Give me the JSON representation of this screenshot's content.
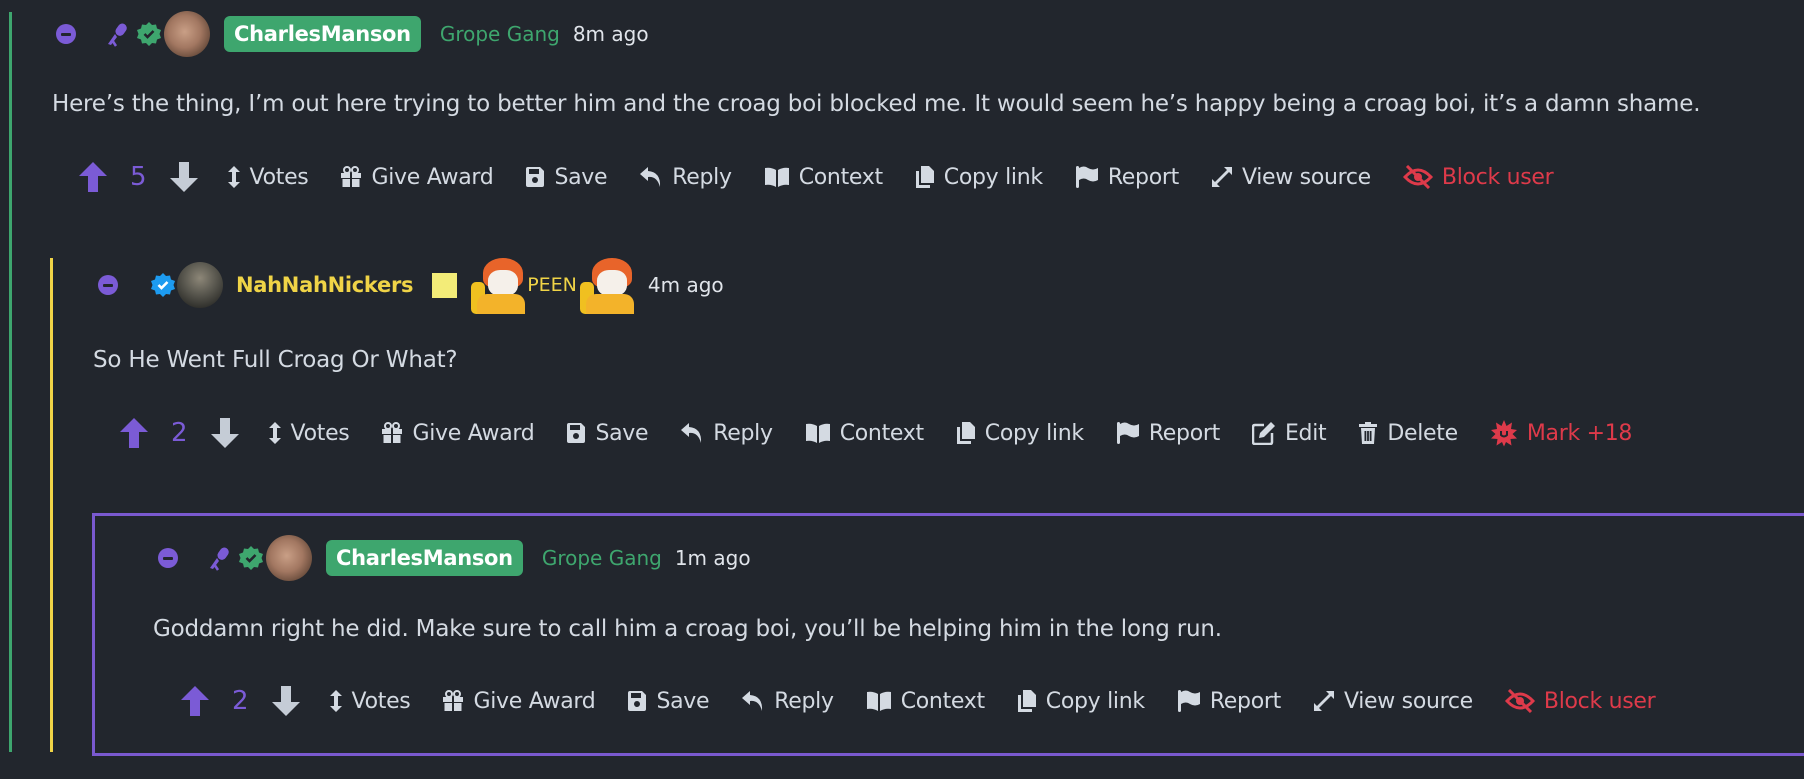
{
  "colors": {
    "background": "#22262d",
    "text": "#d4dae2",
    "accent_purple": "#7b5bd6",
    "green": "#3ea66e",
    "yellow": "#f0d447",
    "danger": "#de3a4a"
  },
  "comments": [
    {
      "username": "CharlesManson",
      "flair": "Grope Gang",
      "time": "8m ago",
      "body": "Here’s the thing, I’m out here trying to better him and the croag boi blocked me. It would seem he’s happy being a croag boi, it’s a damn shame.",
      "score": "5",
      "actions": [
        "Votes",
        "Give Award",
        "Save",
        "Reply",
        "Context",
        "Copy link",
        "Report",
        "View source",
        "Block user"
      ]
    },
    {
      "username": "NahNahNickers",
      "flair": "PEEN",
      "time": "4m ago",
      "body": "So He Went Full Croag Or What?",
      "score": "2",
      "actions": [
        "Votes",
        "Give Award",
        "Save",
        "Reply",
        "Context",
        "Copy link",
        "Report",
        "Edit",
        "Delete",
        "Mark +18"
      ]
    },
    {
      "username": "CharlesManson",
      "flair": "Grope Gang",
      "time": "1m ago",
      "body": "Goddamn right he did. Make sure to call him a croag boi, you’ll be helping him in the long run.",
      "score": "2",
      "actions": [
        "Votes",
        "Give Award",
        "Save",
        "Reply",
        "Context",
        "Copy link",
        "Report",
        "View source",
        "Block user"
      ]
    }
  ],
  "icons": {
    "collapse": "minus-circle-icon",
    "speaker": "microphone-icon",
    "verified": "verified-badge-icon",
    "upvote": "arrow-up-icon",
    "downvote": "arrow-down-icon",
    "votes": "arrows-vertical-icon",
    "award": "gift-icon",
    "save": "floppy-disk-icon",
    "reply": "reply-arrow-icon",
    "context": "book-open-icon",
    "copy_link": "copy-icon",
    "report": "flag-icon",
    "view_source": "expand-icon",
    "block": "eye-slash-icon",
    "edit": "pen-to-square-icon",
    "delete": "trash-icon",
    "mark_nsfw": "burst-icon"
  }
}
